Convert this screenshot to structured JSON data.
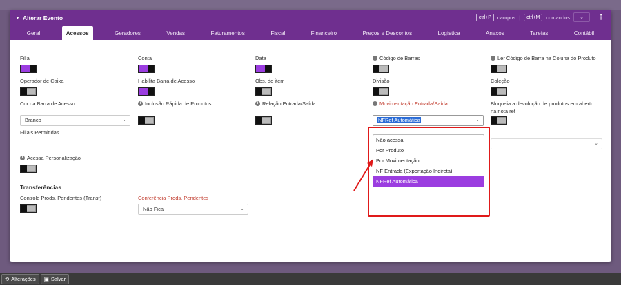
{
  "modal": {
    "title": "Alterar Evento",
    "shortcut_fields_key": "ctrl+P",
    "shortcut_fields_label": "campos",
    "shortcut_commands_key": "ctrl+M",
    "shortcut_commands_label": "comandos"
  },
  "tabs": [
    {
      "label": "Geral"
    },
    {
      "label": "Acessos"
    },
    {
      "label": "Geradores"
    },
    {
      "label": "Vendas"
    },
    {
      "label": "Faturamentos"
    },
    {
      "label": "Fiscal"
    },
    {
      "label": "Financeiro"
    },
    {
      "label": "Preços e Descontos"
    },
    {
      "label": "Logística"
    },
    {
      "label": "Anexos"
    },
    {
      "label": "Tarefas"
    },
    {
      "label": "Contábil"
    }
  ],
  "fields": {
    "filial": "Filial",
    "conta": "Conta",
    "data": "Data",
    "codigo_barras": "Código de Barras",
    "ler_codigo": "Ler Código de Barra na Coluna do Produto",
    "operador_caixa": "Operador de Caixa",
    "habilita_barra": "Habilita Barra de Acesso",
    "obs_item": "Obs. do item",
    "divisao": "Divisão",
    "colecao": "Coleção",
    "cor_barra": "Cor da Barra de Acesso",
    "cor_barra_value": "Branco",
    "inclusao_rapida": "Inclusão Rápida de Produtos",
    "relacao_es": "Relação Entrada/Saída",
    "movimentacao_es": "Movimentação Entrada/Saída",
    "movimentacao_es_value": "NFRef Automática",
    "bloqueia_devolucao_1": "Bloqueia a devolução de produtos em aberto",
    "bloqueia_devolucao_2": "na nota ref",
    "filiais_permitidas": "Filiais Permitidas",
    "acessa_personalizacao": "Acessa Personalização"
  },
  "transferencias": {
    "title": "Transferências",
    "controle_prods": "Controle Prods. Pendentes (Transf)",
    "conferencia_prods": "Conferência Prods. Pendentes",
    "conferencia_value": "Não Fica"
  },
  "dropdown_options": [
    {
      "label": "Não acessa"
    },
    {
      "label": "Por Produto"
    },
    {
      "label": "Por Movimentação"
    },
    {
      "label": "NF Entrada (Exportação Indireta)"
    },
    {
      "label": "NFRef Automática"
    }
  ],
  "bottom_bar": {
    "alteracoes": "Alterações",
    "salvar": "Salvar"
  },
  "colors": {
    "header": "#6f2f8f",
    "accent": "#9b3de0",
    "highlight": "#e01a1a"
  }
}
